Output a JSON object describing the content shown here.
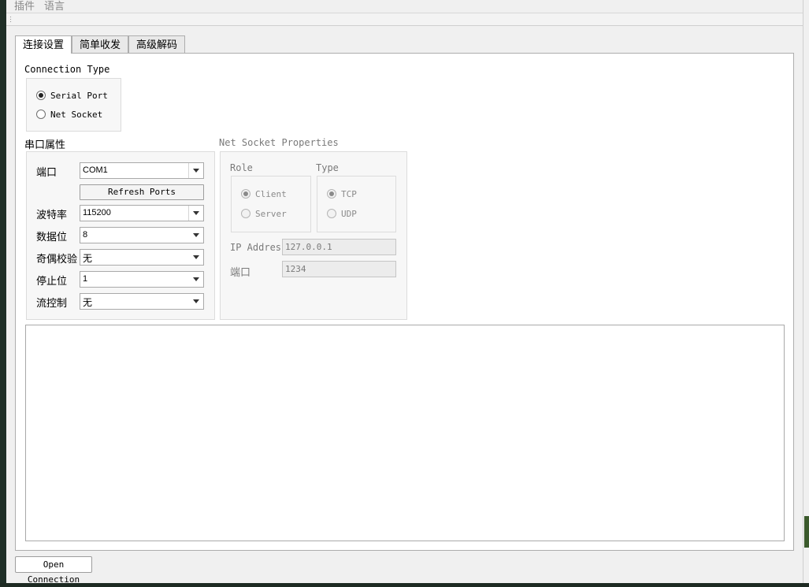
{
  "menu": {
    "items": [
      "插件",
      "语言"
    ]
  },
  "tabs": [
    {
      "label": "连接设置",
      "active": true
    },
    {
      "label": "简单收发",
      "active": false
    },
    {
      "label": "高级解码",
      "active": false
    }
  ],
  "connection_type": {
    "title": "Connection Type",
    "options": [
      {
        "label": "Serial Port",
        "checked": true
      },
      {
        "label": "Net Socket",
        "checked": false
      }
    ]
  },
  "serial": {
    "title": "串口属性",
    "port_label": "端口",
    "port_value": "COM1",
    "refresh_label": "Refresh Ports",
    "baud_label": "波特率",
    "baud_value": "115200",
    "databits_label": "数据位",
    "databits_value": "8",
    "parity_label": "奇偶校验",
    "parity_value": "无",
    "stopbits_label": "停止位",
    "stopbits_value": "1",
    "flow_label": "流控制",
    "flow_value": "无"
  },
  "net": {
    "title": "Net Socket Properties",
    "role_title": "Role",
    "role_options": [
      {
        "label": "Client",
        "checked": true
      },
      {
        "label": "Server",
        "checked": false
      }
    ],
    "type_title": "Type",
    "type_options": [
      {
        "label": "TCP",
        "checked": true
      },
      {
        "label": "UDP",
        "checked": false
      }
    ],
    "ip_label": "IP Address",
    "ip_value": "127.0.0.1",
    "port_label": "端口",
    "port_value": "1234"
  },
  "footer": {
    "open_label": "Open Connection"
  },
  "colors": {
    "window_bg": "#f0f0f0",
    "panel_bg": "#ffffff",
    "disabled_text": "#7a7a7a"
  }
}
